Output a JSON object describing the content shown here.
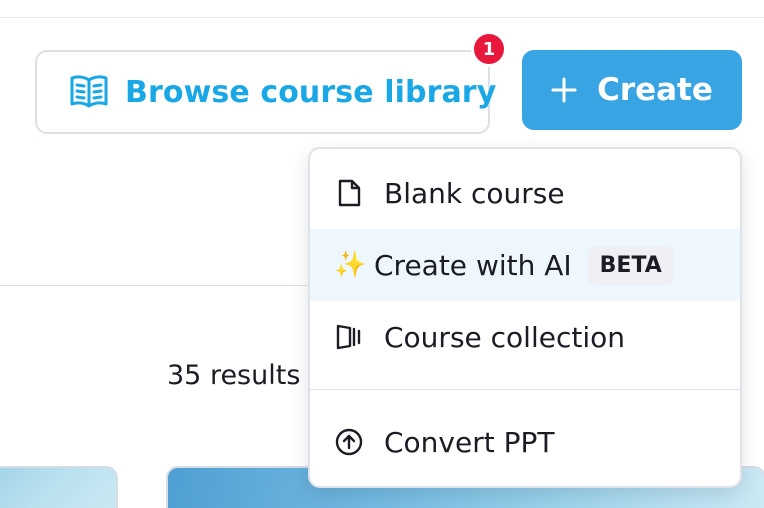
{
  "header": {
    "browse_label": "Browse course library",
    "notification_count": "1",
    "create_label": "Create"
  },
  "results": {
    "count_text": "35 results"
  },
  "dropdown": {
    "items": [
      {
        "label": "Blank course",
        "icon": "file-icon"
      },
      {
        "label": "Create with AI",
        "icon": "sparkles-icon",
        "tag": "BETA"
      },
      {
        "label": "Course collection",
        "icon": "collection-icon"
      },
      {
        "label": "Convert PPT",
        "icon": "upload-circle-icon"
      }
    ]
  },
  "colors": {
    "accent": "#38a4e4",
    "link": "#1aa7e6",
    "badge": "#e8183c",
    "hover_bg": "#eef7fd"
  }
}
